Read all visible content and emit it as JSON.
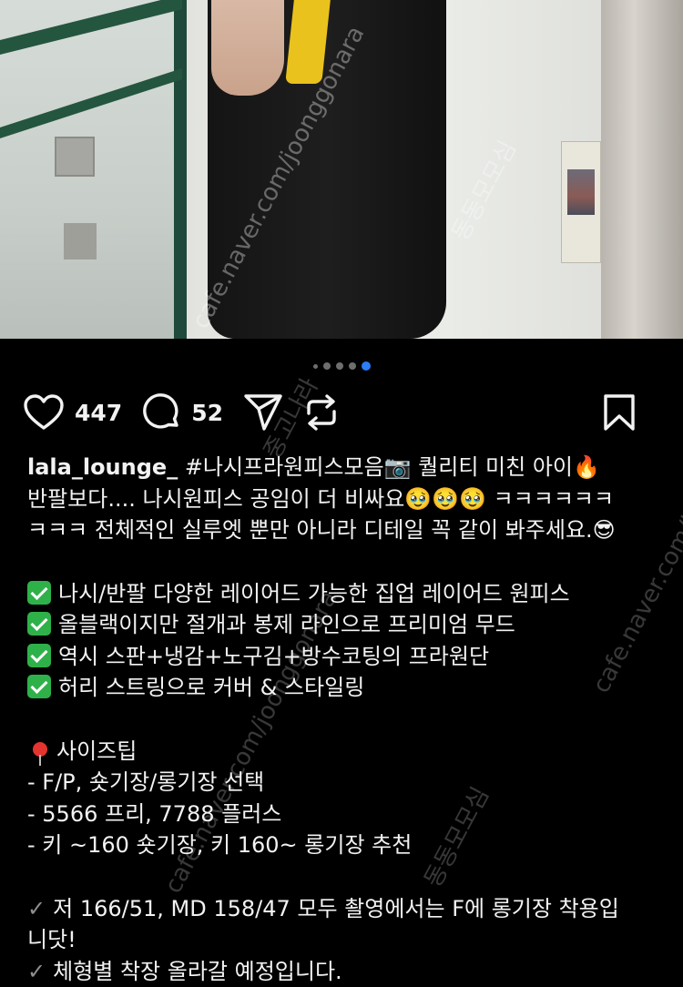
{
  "post": {
    "likes": "447",
    "comments": "52"
  },
  "carousel": {
    "total": 5,
    "active_index": 4
  },
  "caption": {
    "username": "lala_lounge_",
    "line1_text": " #나시프라원피스모음",
    "line1_tail": " 퀄리티 미친 아이",
    "line2": "반팔보다.... 나시원피스 공임이 더 비싸요",
    "line2_tail": " ㅋㅋㅋㅋㅋㅋ",
    "line3": "ㅋㅋㅋ 전체적인 실루엣 뿐만 아니라 디테일 꼭 같이 봐주세요.",
    "features": [
      "나시/반팔 다양한 레이어드 가능한 집업 레이어드 원피스",
      "올블랙이지만 절개과 봉제 라인으로 프리미엄 무드",
      "역시 스판+냉감+노구김+방수코팅의 프라원단",
      "허리 스트링으로 커버 & 스타일링"
    ],
    "size_title": "사이즈팁",
    "size_tips": [
      "- F/P, 숏기장/롱기장 선택",
      "- 5566 프리, 7788 플러스",
      "- 키 ~160 숏기장, 키 160~ 롱기장 추천"
    ],
    "notes": [
      "저 166/51, MD 158/47 모두 촬영에서는 F에 롱기장 착용입",
      "니닷!",
      "체형별 착장 올라갈 예정입니다."
    ]
  },
  "watermarks": {
    "site": "cafe.naver.com/joonggonara",
    "name": "중고나라",
    "badge": "동동모모심"
  },
  "icons": {
    "like": "heart-icon",
    "comment": "comment-bubble-icon",
    "share": "paper-plane-icon",
    "repost": "repost-icon",
    "save": "bookmark-icon"
  }
}
